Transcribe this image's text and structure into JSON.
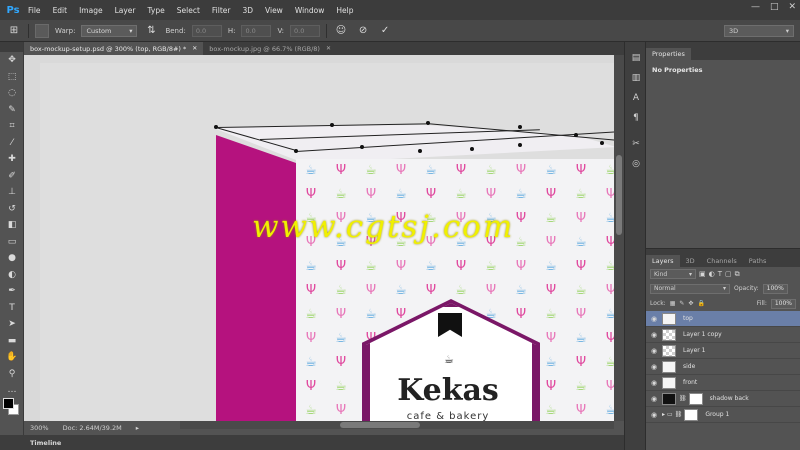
{
  "app": {
    "logo": "Ps"
  },
  "menu": [
    "File",
    "Edit",
    "Image",
    "Layer",
    "Type",
    "Select",
    "Filter",
    "3D",
    "View",
    "Window",
    "Help"
  ],
  "window_controls": [
    "—",
    "□",
    "✕"
  ],
  "options_bar": {
    "warp_label": "Warp:",
    "warp_value": "Custom",
    "bend_label": "Bend:",
    "bend_value": "0.0",
    "h_label": "H:",
    "h_value": "0.0",
    "v_label": "V:",
    "v_value": "0.0",
    "workspace": "3D"
  },
  "doc_tabs": [
    {
      "label": "box-mockup-setup.psd @ 300% (top, RGB/8#) *",
      "active": true
    },
    {
      "label": "box-mockup.jpg @ 66.7% (RGB/8)",
      "active": false
    }
  ],
  "canvas": {
    "watermark": "www.cgtsj.com",
    "brand": "Kekas",
    "tagline": "cafe & bakery"
  },
  "status": {
    "zoom": "300%",
    "doc": "Doc: 2.64M/39.2M"
  },
  "timeline_label": "Timeline",
  "properties": {
    "tab": "Properties",
    "body": "No Properties"
  },
  "layers_panel": {
    "tabs": [
      "Layers",
      "3D",
      "Channels",
      "Paths"
    ],
    "filter_kind": "Kind",
    "blend_mode": "Normal",
    "opacity_label": "Opacity:",
    "opacity_value": "100%",
    "lock_label": "Lock:",
    "fill_label": "Fill:",
    "fill_value": "100%",
    "layers": [
      {
        "name": "top",
        "selected": true,
        "thumb": "smart"
      },
      {
        "name": "Layer 1 copy",
        "selected": false,
        "thumb": "checker"
      },
      {
        "name": "Layer 1",
        "selected": false,
        "thumb": "checker"
      },
      {
        "name": "side",
        "selected": false,
        "thumb": "smart"
      },
      {
        "name": "front",
        "selected": false,
        "thumb": "smart"
      },
      {
        "name": "shadow back",
        "selected": false,
        "thumb": "black"
      },
      {
        "name": "Group 1",
        "selected": false,
        "thumb": "group"
      }
    ]
  },
  "colors": {
    "ps_blue": "#31a8ff",
    "box_magenta": "#b5127e",
    "label_border": "#7a1767",
    "watermark_yellow": "#f0f000",
    "selected_layer": "#6a7fa8"
  }
}
